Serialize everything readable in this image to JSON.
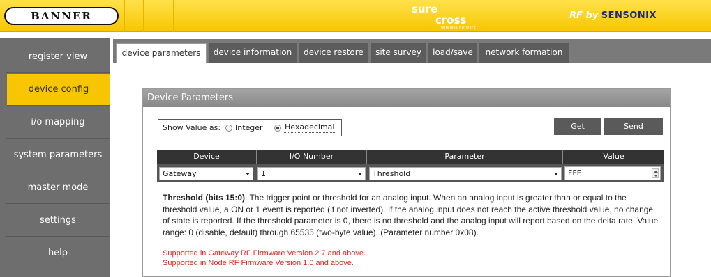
{
  "header": {
    "banner_logo": "BANNER",
    "surecross_sure": "sure",
    "surecross_cross": "cross",
    "surecross_sub": "wireless network",
    "rf_by": "RF by",
    "sensonix": "SENSONIX"
  },
  "sidebar": {
    "items": [
      {
        "label": "register view"
      },
      {
        "label": "device config"
      },
      {
        "label": "i/o mapping"
      },
      {
        "label": "system parameters"
      },
      {
        "label": "master mode"
      },
      {
        "label": "settings"
      },
      {
        "label": "help"
      }
    ],
    "active_index": 1
  },
  "tabs": [
    {
      "label": "device parameters"
    },
    {
      "label": "device information"
    },
    {
      "label": "device restore"
    },
    {
      "label": "site survey"
    },
    {
      "label": "load/save"
    },
    {
      "label": "network formation"
    }
  ],
  "panel": {
    "title": "Device Parameters",
    "show_value_label": "Show Value as:",
    "radio_integer": "Integer",
    "radio_hex": "Hexadecimal",
    "selected_format": "Hexadecimal",
    "get_label": "Get",
    "send_label": "Send",
    "columns": [
      "Device",
      "I/O Number",
      "Parameter",
      "Value"
    ],
    "device_value": "Gateway",
    "io_value": "1",
    "parameter_value": "Threshold",
    "value": "FFF",
    "desc_bold": "Threshold (bits 15:0)",
    "desc_text": ". The trigger point or threshold for an analog input. When an analog input is greater than or equal to the threshold value, a ON or 1 event is reported (if not inverted). If the analog input does not reach the active threshold value, no change of state is reported. If the threshold parameter is 0, there is no threshold and the analog input will report based on the delta rate. Value range: 0 (disable, default) through 65535 (two-byte value). (Parameter number 0x08).",
    "support_gateway": "Supported in Gateway RF Firmware Version 2.7 and above.",
    "support_node": "Supported in Node RF Firmware Version 1.0 and above."
  },
  "colors": {
    "header_yellow": "#f7c600",
    "sidebar_gray": "#6e6e6e",
    "warning_red": "#e0281e"
  }
}
